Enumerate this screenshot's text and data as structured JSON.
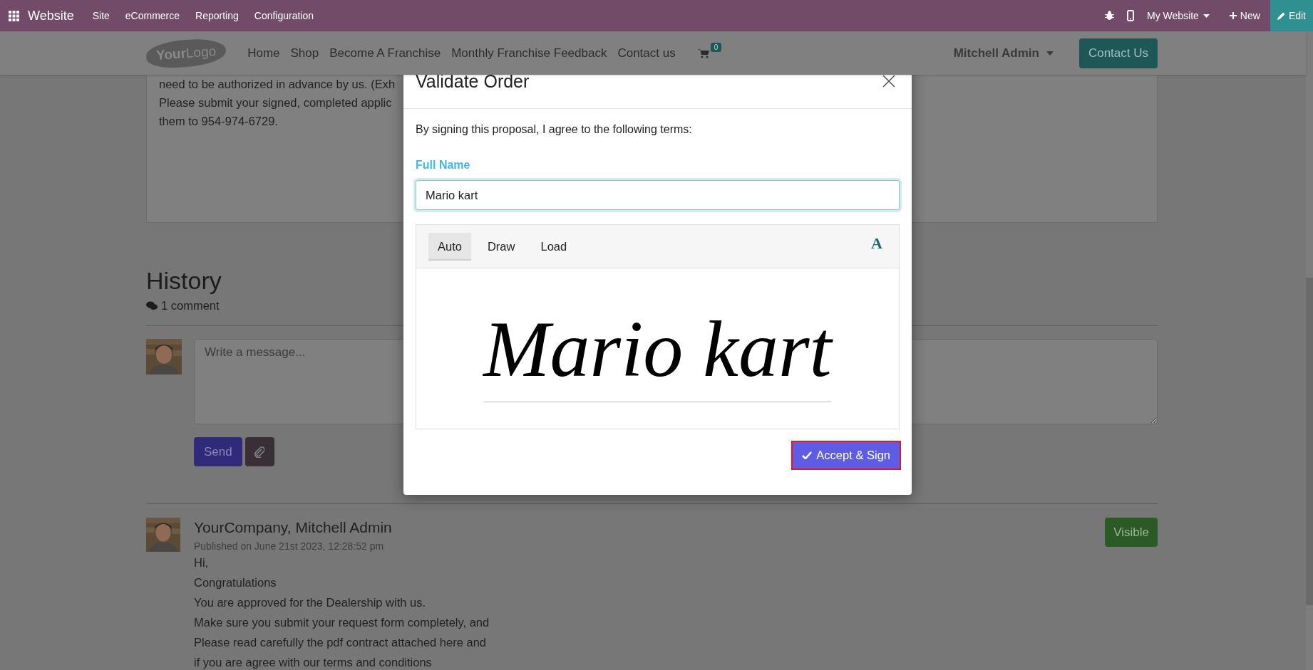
{
  "top_bar": {
    "app": "Website",
    "menu": [
      "Site",
      "eCommerce",
      "Reporting",
      "Configuration"
    ],
    "website_switcher": "My Website",
    "new_button": "New",
    "edit_button": "Edit"
  },
  "site_header": {
    "logo": "**Your**Logo",
    "nav": [
      "Home",
      "Shop",
      "Become A Franchise",
      "Monthly Franchise Feedback",
      "Contact us"
    ],
    "cart_count": "0",
    "user": "Mitchell Admin",
    "contact_button": "Contact Us"
  },
  "intro_lines": [
    "need to be authorized in advance by us. (Exh",
    "Please submit your signed, completed applic",
    "them to 954-974-6729."
  ],
  "history": {
    "title": "History",
    "comment_count": "1 comment",
    "composer": {
      "placeholder": "Write a message...",
      "send_button": "Send"
    }
  },
  "messages": [
    {
      "author": "YourCompany, Mitchell Admin",
      "published": "Published on June 21st 2023, 12:28:52 pm",
      "badge": "Visible",
      "lines": [
        "Hi,",
        "Congratulations",
        "You are approved for the Dealership with us.",
        "Make sure you submit your request form completely, and",
        "Please read carefully the pdf contract attached here and",
        "if you are agree with our terms and conditions"
      ]
    }
  ],
  "dialog": {
    "title": "Validate Order",
    "terms": "By signing this proposal, I agree to the following terms:",
    "field_label": "Full Name",
    "full_name": "Mario kart",
    "modes": [
      {
        "label": "Auto",
        "selected": true
      },
      {
        "label": "Draw",
        "selected": false
      },
      {
        "label": "Load",
        "selected": false
      }
    ],
    "font_button": "A",
    "signature": "Mario kart",
    "submit_button": "Accept & Sign"
  }
}
